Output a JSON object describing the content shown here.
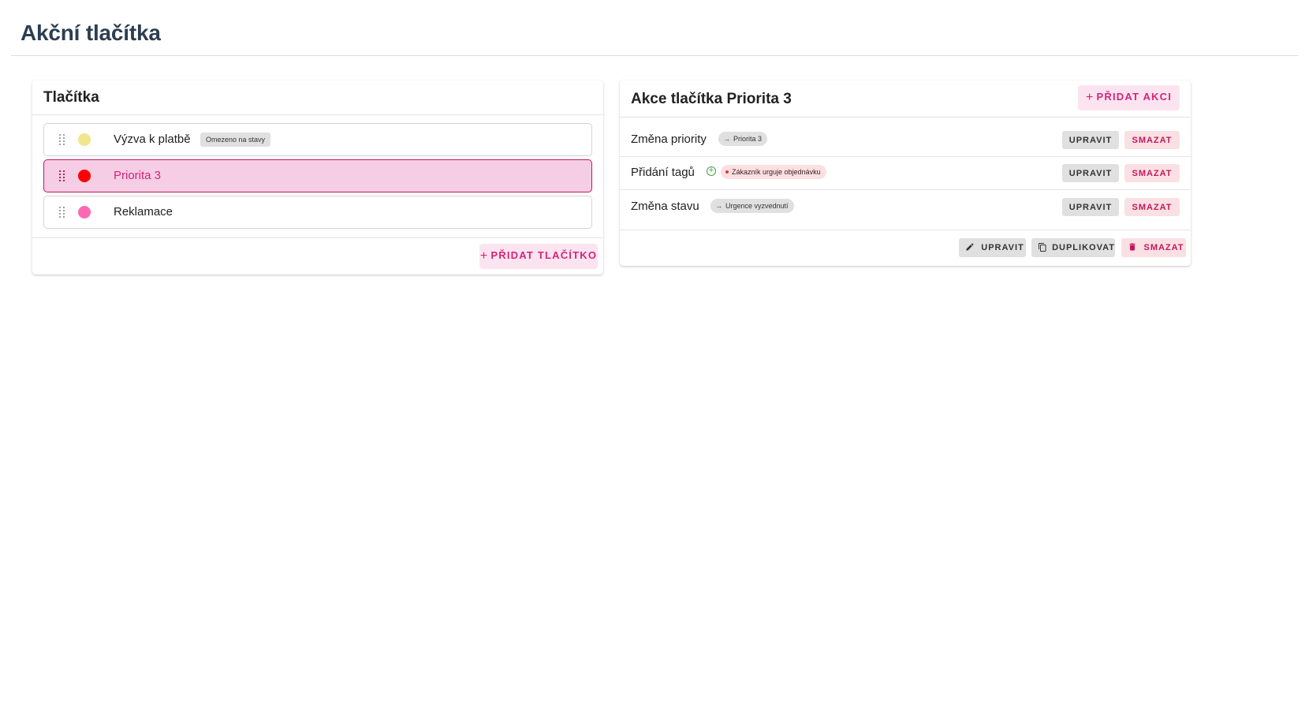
{
  "page": {
    "title": "Akční tlačítka"
  },
  "buttons_panel": {
    "title": "Tlačítka",
    "items": [
      {
        "label": "Výzva k platbě",
        "color": "#f0e68c",
        "chip": "Omezeno na stavy",
        "selected": false
      },
      {
        "label": "Priorita 3",
        "color": "#ff0000",
        "chip": "",
        "selected": true
      },
      {
        "label": "Reklamace",
        "color": "#ff69b4",
        "chip": "",
        "selected": false
      }
    ],
    "add_button": "PŘIDAT TLAČÍTKO"
  },
  "actions_panel": {
    "title": "Akce tlačítka Priorita 3",
    "add_button": "PŘIDAT AKCI",
    "rows": [
      {
        "name": "Změna priority",
        "pill": "Priorita 3",
        "edit": "UPRAVIT",
        "delete": "SMAZAT"
      },
      {
        "name": "Přidání tagů",
        "pill": "Zákazník urguje objednávku",
        "edit": "UPRAVIT",
        "delete": "SMAZAT"
      },
      {
        "name": "Změna stavu",
        "pill": "Urgence vyzvednutí",
        "edit": "UPRAVIT",
        "delete": "SMAZAT"
      }
    ],
    "footer": {
      "edit": "UPRAVIT",
      "duplicate": "DUPLIKOVAT",
      "delete": "SMAZAT"
    }
  },
  "colors": {
    "accent": "#d6247a",
    "accent_light": "#fbe4f0",
    "title": "#2c3e50"
  }
}
